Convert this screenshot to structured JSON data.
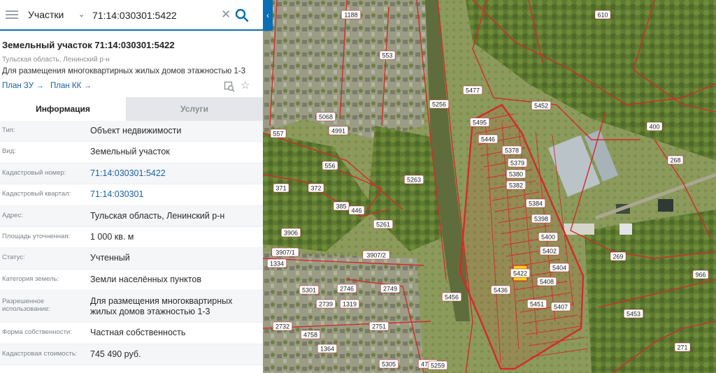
{
  "search": {
    "type_label": "Участки",
    "query": "71:14:030301:5422"
  },
  "object": {
    "title": "Земельный участок 71:14:030301:5422",
    "region": "Тульская область, Ленинский р-н",
    "purpose": "Для размещения многоквартирных жилых домов этажностью 1-3",
    "plan_zu": "План ЗУ →",
    "plan_kk": "План КК →"
  },
  "tabs": {
    "info": "Информация",
    "services": "Услуги"
  },
  "properties": [
    {
      "label": "Тип:",
      "value": "Объект недвижимости",
      "link": false
    },
    {
      "label": "Вид:",
      "value": "Земельный участок",
      "link": false
    },
    {
      "label": "Кадастровый номер:",
      "value": "71:14:030301:5422",
      "link": true
    },
    {
      "label": "Кадастровый квартал:",
      "value": "71:14:030301",
      "link": true
    },
    {
      "label": "Адрес:",
      "value": "Тульская область, Ленинский р-н",
      "link": false
    },
    {
      "label": "Площадь уточненная:",
      "value": "1 000 кв. м",
      "link": false
    },
    {
      "label": "Статус:",
      "value": "Учтенный",
      "link": false
    },
    {
      "label": "Категория земель:",
      "value": "Земли населённых пунктов",
      "link": false
    },
    {
      "label": "Разрешенное использование:",
      "value": "Для размещения многоквартирных жилых домов этажностью 1-3",
      "link": false
    },
    {
      "label": "Форма собственности:",
      "value": "Частная собственность",
      "link": false
    },
    {
      "label": "Кадастровая стоимость:",
      "value": "745 490 руб.",
      "link": false
    }
  ],
  "map": {
    "parcel_labels": [
      {
        "text": "610"
      },
      {
        "text": "553"
      },
      {
        "text": "5477"
      },
      {
        "text": "5452"
      },
      {
        "text": "400"
      },
      {
        "text": "268"
      },
      {
        "text": "5256"
      },
      {
        "text": "5495"
      },
      {
        "text": "5446"
      },
      {
        "text": "5378"
      },
      {
        "text": "5379"
      },
      {
        "text": "5380"
      },
      {
        "text": "5382"
      },
      {
        "text": "5384"
      },
      {
        "text": "5398"
      },
      {
        "text": "5400"
      },
      {
        "text": "5402"
      },
      {
        "text": "5404"
      },
      {
        "text": "5451"
      },
      {
        "text": "5407"
      },
      {
        "text": "5453"
      },
      {
        "text": "269"
      },
      {
        "text": "5456"
      },
      {
        "text": "557"
      },
      {
        "text": "556"
      },
      {
        "text": "371"
      },
      {
        "text": "372"
      },
      {
        "text": "385"
      },
      {
        "text": "446"
      },
      {
        "text": "3906"
      },
      {
        "text": "5261"
      },
      {
        "text": "5263"
      },
      {
        "text": "3907/1"
      },
      {
        "text": "3907/2"
      },
      {
        "text": "1334"
      },
      {
        "text": "2746"
      },
      {
        "text": "2739"
      },
      {
        "text": "2751"
      },
      {
        "text": "4758"
      },
      {
        "text": "1364"
      },
      {
        "text": "5305"
      },
      {
        "text": "4787"
      },
      {
        "text": "5259"
      },
      {
        "text": "1188"
      },
      {
        "text": "4991"
      },
      {
        "text": "5068"
      },
      {
        "text": "1319"
      },
      {
        "text": "2732"
      },
      {
        "text": "2749"
      },
      {
        "text": "5301"
      },
      {
        "text": "966"
      },
      {
        "text": "271"
      },
      {
        "text": "5422"
      },
      {
        "text": "5436"
      },
      {
        "text": "5408"
      }
    ],
    "highlight_color": "#f2d21a",
    "boundary_color": "#d42a2a"
  }
}
